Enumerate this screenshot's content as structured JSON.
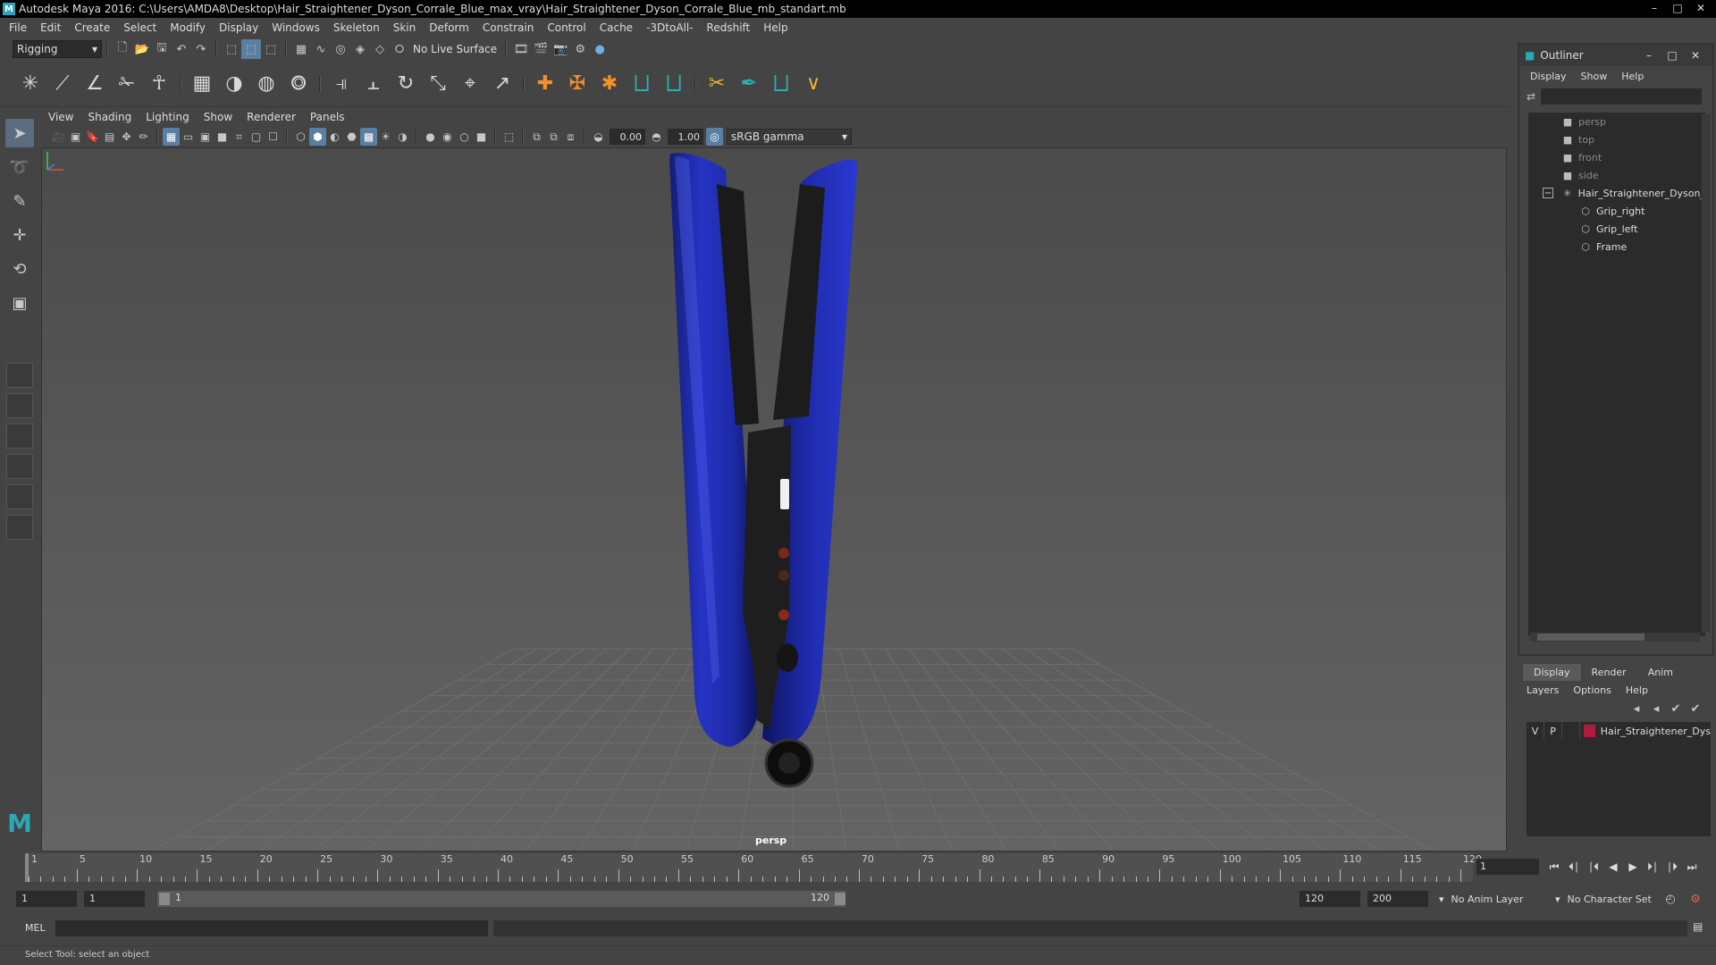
{
  "window": {
    "title": "Autodesk Maya 2016: C:\\Users\\AMDA8\\Desktop\\Hair_Straightener_Dyson_Corrale_Blue_max_vray\\Hair_Straightener_Dyson_Corrale_Blue_mb_standart.mb",
    "app_icon": "M"
  },
  "menubar": [
    "File",
    "Edit",
    "Create",
    "Select",
    "Modify",
    "Display",
    "Windows",
    "Skeleton",
    "Skin",
    "Deform",
    "Constrain",
    "Control",
    "Cache",
    "-3DtoAll-",
    "Redshift",
    "Help"
  ],
  "statusline": {
    "mode": "Rigging",
    "live_surface": "No Live Surface"
  },
  "panel": {
    "menus": [
      "View",
      "Shading",
      "Lighting",
      "Show",
      "Renderer",
      "Panels"
    ],
    "exposure": "0.00",
    "gamma": "1.00",
    "color_space": "sRGB gamma",
    "camera_label": "persp"
  },
  "outliner": {
    "title": "Outliner",
    "menus": [
      "Display",
      "Show",
      "Help"
    ],
    "cameras": [
      "persp",
      "top",
      "front",
      "side"
    ],
    "group": "Hair_Straightener_Dyson_",
    "children": [
      "Grip_right",
      "Grip_left",
      "Frame"
    ]
  },
  "layer_editor": {
    "tabs": [
      "Display",
      "Render",
      "Anim"
    ],
    "active_tab": "Display",
    "menus": [
      "Layers",
      "Options",
      "Help"
    ],
    "layer": {
      "visible": "V",
      "playback": "P",
      "name": "Hair_Straightener_Dys",
      "color": "#b01a3c"
    }
  },
  "timeslider": {
    "start": 1,
    "end": 120,
    "labels": [
      "1",
      "5",
      "10",
      "15",
      "20",
      "25",
      "30",
      "35",
      "40",
      "45",
      "50",
      "55",
      "60",
      "65",
      "70",
      "75",
      "80",
      "85",
      "90",
      "95",
      "100",
      "105",
      "110",
      "115",
      "120"
    ],
    "current_frame": "1"
  },
  "rangeslider": {
    "start_field": "1",
    "playback_start": "1",
    "range_start_label": "1",
    "range_end_label": "120",
    "playback_end": "120",
    "end_field": "200",
    "anim_layer": "No Anim Layer",
    "character_set": "No Character Set"
  },
  "commandline": {
    "label": "MEL"
  },
  "helpline": "Select Tool: select an object"
}
